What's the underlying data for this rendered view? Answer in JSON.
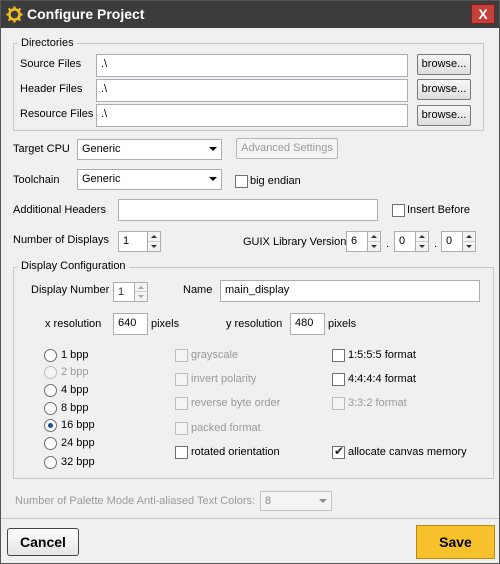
{
  "window": {
    "title": "Configure Project",
    "close_label": "X",
    "icon": "gear-icon"
  },
  "directories": {
    "legend": "Directories",
    "rows": [
      {
        "label": "Source Files",
        "value": ".\\",
        "button": "browse..."
      },
      {
        "label": "Header Files",
        "value": ".\\",
        "button": "browse..."
      },
      {
        "label": "Resource Files",
        "value": ".\\",
        "button": "browse..."
      }
    ]
  },
  "target_cpu": {
    "label": "Target CPU",
    "value": "Generic",
    "advanced_button": "Advanced Settings"
  },
  "toolchain": {
    "label": "Toolchain",
    "value": "Generic",
    "big_endian_label": "big endian",
    "big_endian_checked": false
  },
  "additional_headers": {
    "label": "Additional Headers",
    "value": "",
    "insert_before_label": "Insert Before",
    "insert_before_checked": false
  },
  "number_of_displays": {
    "label": "Number of Displays",
    "value": "1"
  },
  "guix_version": {
    "label": "GUIX Library Version",
    "major": "6",
    "minor": "0",
    "patch": "0",
    "sep": "."
  },
  "display_config": {
    "legend": "Display Configuration",
    "display_number_label": "Display Number",
    "display_number": "1",
    "name_label": "Name",
    "name_value": "main_display",
    "x_res_label": "x resolution",
    "x_res_value": "640",
    "x_res_unit": "pixels",
    "y_res_label": "y resolution",
    "y_res_value": "480",
    "y_res_unit": "pixels",
    "bpp_options": [
      {
        "label": "1 bpp",
        "selected": false,
        "enabled": true
      },
      {
        "label": "2 bpp",
        "selected": false,
        "enabled": false
      },
      {
        "label": "4 bpp",
        "selected": false,
        "enabled": true
      },
      {
        "label": "8 bpp",
        "selected": false,
        "enabled": true
      },
      {
        "label": "16 bpp",
        "selected": true,
        "enabled": true
      },
      {
        "label": "24 bpp",
        "selected": false,
        "enabled": true
      },
      {
        "label": "32 bpp",
        "selected": false,
        "enabled": true
      }
    ],
    "middle_options": [
      {
        "label": "grayscale",
        "checked": false,
        "enabled": false
      },
      {
        "label": "invert polarity",
        "checked": false,
        "enabled": false
      },
      {
        "label": "reverse byte order",
        "checked": false,
        "enabled": false
      },
      {
        "label": "packed format",
        "checked": false,
        "enabled": false
      },
      {
        "label": "rotated orientation",
        "checked": false,
        "enabled": true
      }
    ],
    "right_options": [
      {
        "label": "1:5:5:5 format",
        "checked": false,
        "enabled": true
      },
      {
        "label": "4:4:4:4 format",
        "checked": false,
        "enabled": true
      },
      {
        "label": "3:3:2 format",
        "checked": false,
        "enabled": false
      },
      {
        "label": "allocate canvas memory",
        "checked": true,
        "enabled": true
      }
    ]
  },
  "palette": {
    "label": "Number of Palette Mode Anti-aliased Text Colors:",
    "value": "8"
  },
  "footer": {
    "cancel_label": "Cancel",
    "save_label": "Save"
  },
  "colors": {
    "save_accent": "#f7c12b",
    "titlebar": "#3c3c3c",
    "close": "#c4403c"
  }
}
